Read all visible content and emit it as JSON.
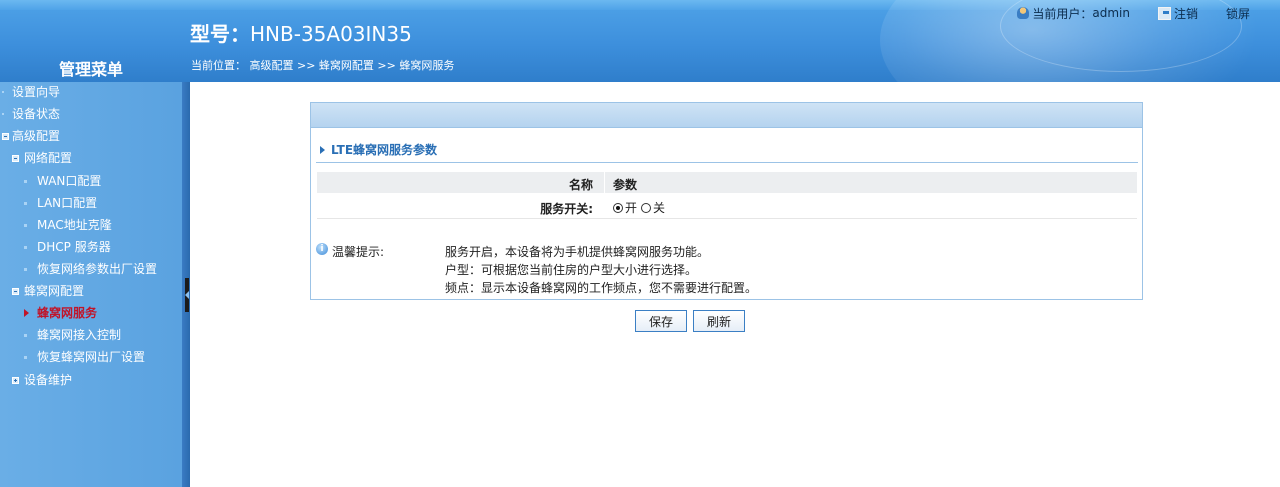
{
  "header": {
    "model_label": "型号：",
    "model_value": "HNB-35A03IN35",
    "current_user_label": "当前用户：",
    "current_user": "admin",
    "logout": "注销",
    "lock": "锁屏"
  },
  "breadcrumb": {
    "prefix": "当前位置：",
    "path": "高级配置 >> 蜂窝网配置 >> 蜂窝网服务"
  },
  "sidebar": {
    "title": "管理菜单",
    "items": [
      {
        "label": "设置向导"
      },
      {
        "label": "设备状态"
      },
      {
        "label": "高级配置"
      },
      {
        "label": "网络配置"
      },
      {
        "label": "WAN口配置"
      },
      {
        "label": "LAN口配置"
      },
      {
        "label": "MAC地址克隆"
      },
      {
        "label": "DHCP 服务器"
      },
      {
        "label": "恢复网络参数出厂设置"
      },
      {
        "label": "蜂窝网配置"
      },
      {
        "label": "蜂窝网服务"
      },
      {
        "label": "蜂窝网接入控制"
      },
      {
        "label": "恢复蜂窝网出厂设置"
      },
      {
        "label": "设备维护"
      }
    ]
  },
  "panel": {
    "section_title": "LTE蜂窝网服务参数",
    "col_name": "名称",
    "col_param": "参数",
    "service_switch_label": "服务开关:",
    "radio_on": "开",
    "radio_off": "关",
    "radio_selected": "开",
    "tip_label": "温馨提示:",
    "tips": [
      "服务开启，本设备将为手机提供蜂窝网服务功能。",
      "户型：可根据您当前住房的户型大小进行选择。",
      "频点：显示本设备蜂窝网的工作频点，您不需要进行配置。"
    ]
  },
  "buttons": {
    "save": "保存",
    "refresh": "刷新"
  },
  "colors": {
    "header_blue": "#3d8fdc",
    "sidebar_blue": "#5aa2e0",
    "active_item": "#c0152a",
    "panel_border": "#9cc3e6"
  }
}
